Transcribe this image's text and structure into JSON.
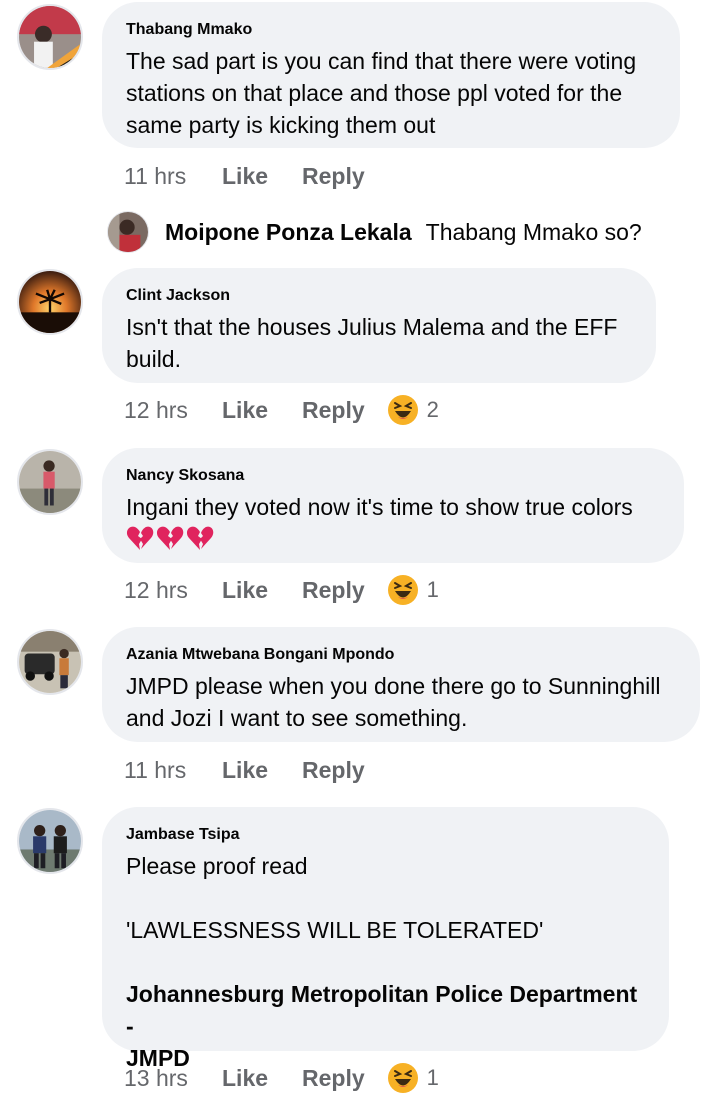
{
  "comments": [
    {
      "name": "Thabang Mmako",
      "lines": [
        "The sad part is you can find that there were voting",
        "stations on that place and those ppl voted for the",
        "same party is kicking them out"
      ],
      "time": "11 hrs",
      "like": "Like",
      "reply": "Reply"
    },
    {
      "name": "Clint Jackson",
      "lines": [
        "Isn't that the houses Julius Malema and the EFF",
        "build."
      ],
      "time": "12 hrs",
      "like": "Like",
      "reply": "Reply",
      "reaction": {
        "icon": "laughing-emoji",
        "count": "2"
      }
    },
    {
      "name": "Nancy Skosana",
      "lines": [
        "Ingani they voted now it's time to show true colors"
      ],
      "emojis": [
        "broken-heart-emoji",
        "broken-heart-emoji",
        "broken-heart-emoji"
      ],
      "time": "12 hrs",
      "like": "Like",
      "reply": "Reply",
      "reaction": {
        "icon": "laughing-emoji",
        "count": "1"
      }
    },
    {
      "name": "Azania Mtwebana Bongani Mpondo",
      "lines": [
        "JMPD please when you done there go to Sunninghill",
        "and Jozi I want to see something."
      ],
      "time": "11 hrs",
      "like": "Like",
      "reply": "Reply"
    },
    {
      "name": "Jambase Tsipa",
      "lines": [
        "Please proof read",
        "'LAWLESSNESS WILL BE TOLERATED'",
        "Johannesburg Metropolitan Police Department -",
        "JMPD"
      ],
      "time": "13 hrs",
      "like": "Like",
      "reply": "Reply",
      "reaction": {
        "icon": "laughing-emoji",
        "count": "1"
      }
    }
  ],
  "reply": {
    "name": "Moipone Ponza Lekala",
    "text": "Thabang Mmako so?"
  },
  "colors": {
    "bubble": "#f0f2f5",
    "secondary_text": "#65676b",
    "emoji_yellow": "#f7b125",
    "heart_red": "#e0245e"
  }
}
